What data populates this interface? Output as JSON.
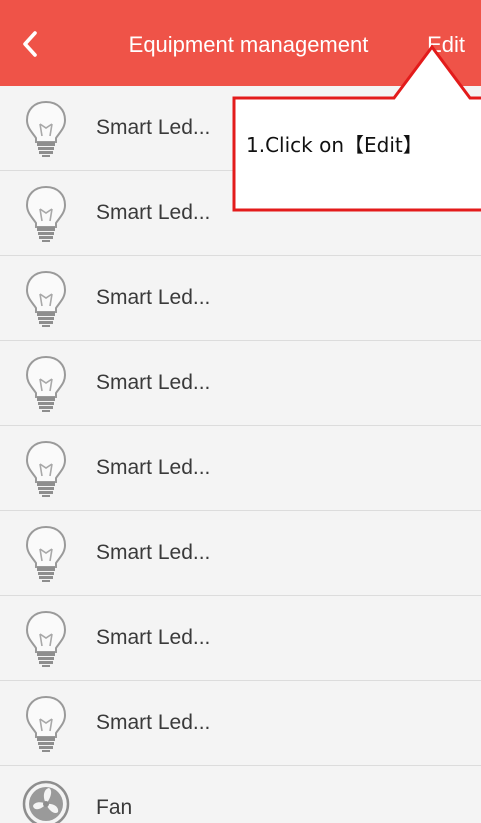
{
  "header": {
    "back_icon": "chevron-left-icon",
    "title": "Equipment management",
    "edit_label": "Edit",
    "background_color": "#ef5348"
  },
  "devices": [
    {
      "label": "Smart Led...",
      "icon": "lightbulb-icon"
    },
    {
      "label": "Smart Led...",
      "icon": "lightbulb-icon"
    },
    {
      "label": "Smart Led...",
      "icon": "lightbulb-icon"
    },
    {
      "label": "Smart Led...",
      "icon": "lightbulb-icon"
    },
    {
      "label": "Smart Led...",
      "icon": "lightbulb-icon"
    },
    {
      "label": "Smart Led...",
      "icon": "lightbulb-icon"
    },
    {
      "label": "Smart Led...",
      "icon": "lightbulb-icon"
    },
    {
      "label": "Smart Led...",
      "icon": "lightbulb-icon"
    },
    {
      "label": "Fan",
      "icon": "fan-icon"
    }
  ],
  "annotation": {
    "text": "1.Click on【Edit】",
    "border_color": "#e31b1b"
  }
}
